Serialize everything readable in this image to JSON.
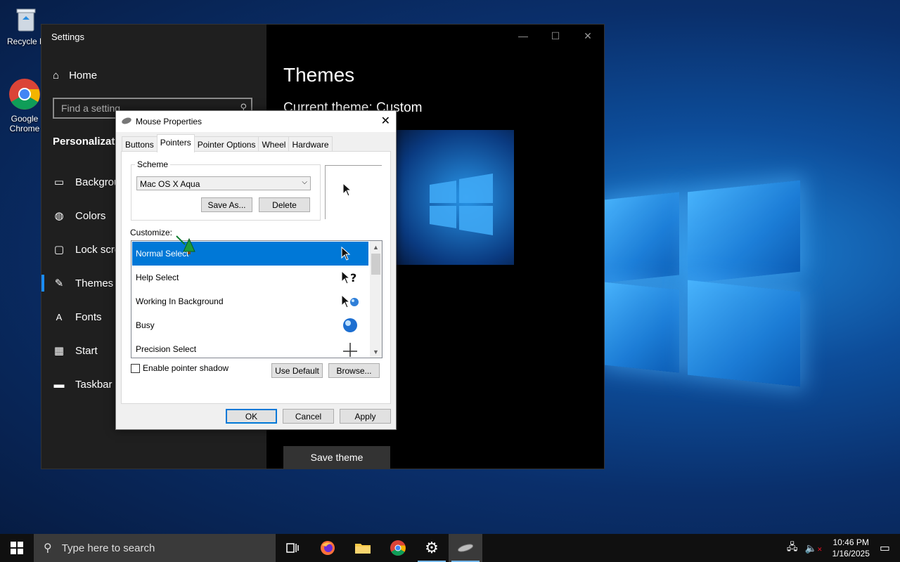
{
  "desktop": {
    "icons": [
      {
        "label": "Recycle B",
        "icon": "recycle-bin-icon"
      },
      {
        "label": "Google Chrome",
        "icon": "chrome-icon"
      }
    ]
  },
  "settings": {
    "app_title": "Settings",
    "home_label": "Home",
    "search_placeholder": "Find a setting",
    "section_title": "Personalizatio",
    "nav": [
      {
        "label": "Backgrou",
        "icon": "image-icon"
      },
      {
        "label": "Colors",
        "icon": "palette-icon"
      },
      {
        "label": "Lock scree",
        "icon": "lock-screen-icon"
      },
      {
        "label": "Themes",
        "icon": "themes-icon",
        "selected": true
      },
      {
        "label": "Fonts",
        "icon": "font-icon"
      },
      {
        "label": "Start",
        "icon": "start-grid-icon"
      },
      {
        "label": "Taskbar",
        "icon": "taskbar-icon"
      }
    ],
    "page_title": "Themes",
    "current_theme": "Current theme: Custom",
    "save_theme_label": "Save theme",
    "window_buttons": {
      "minimize": "—",
      "maximize": "☐",
      "close": "✕"
    }
  },
  "mouse_dialog": {
    "title": "Mouse Properties",
    "tabs": [
      {
        "label": "Buttons"
      },
      {
        "label": "Pointers",
        "active": true
      },
      {
        "label": "Pointer Options"
      },
      {
        "label": "Wheel"
      },
      {
        "label": "Hardware"
      }
    ],
    "scheme_label": "Scheme",
    "scheme_value": "Mac OS X Aqua",
    "save_as_label": "Save As...",
    "delete_label": "Delete",
    "customize_label": "Customize:",
    "pointers": [
      {
        "label": "Normal Select",
        "icon": "arrow-pointer-icon",
        "selected": true
      },
      {
        "label": "Help Select",
        "icon": "help-pointer-icon"
      },
      {
        "label": "Working In Background",
        "icon": "working-pointer-icon"
      },
      {
        "label": "Busy",
        "icon": "busy-pointer-icon"
      },
      {
        "label": "Precision Select",
        "icon": "crosshair-pointer-icon"
      }
    ],
    "shadow_label": "Enable pointer shadow",
    "use_default_label": "Use Default",
    "browse_label": "Browse...",
    "ok_label": "OK",
    "cancel_label": "Cancel",
    "apply_label": "Apply"
  },
  "taskbar": {
    "search_placeholder": "Type here to search",
    "time": "10:46 PM",
    "date": "1/16/2025",
    "apps": [
      {
        "name": "task-view-icon"
      },
      {
        "name": "firefox-icon"
      },
      {
        "name": "file-explorer-icon"
      },
      {
        "name": "chrome-icon"
      },
      {
        "name": "settings-gear-icon"
      },
      {
        "name": "mouse-icon"
      }
    ]
  },
  "colors": {
    "accent": "#0078d7",
    "selection": "#0078d7",
    "settings_sidebar": "#1f1f1f"
  }
}
